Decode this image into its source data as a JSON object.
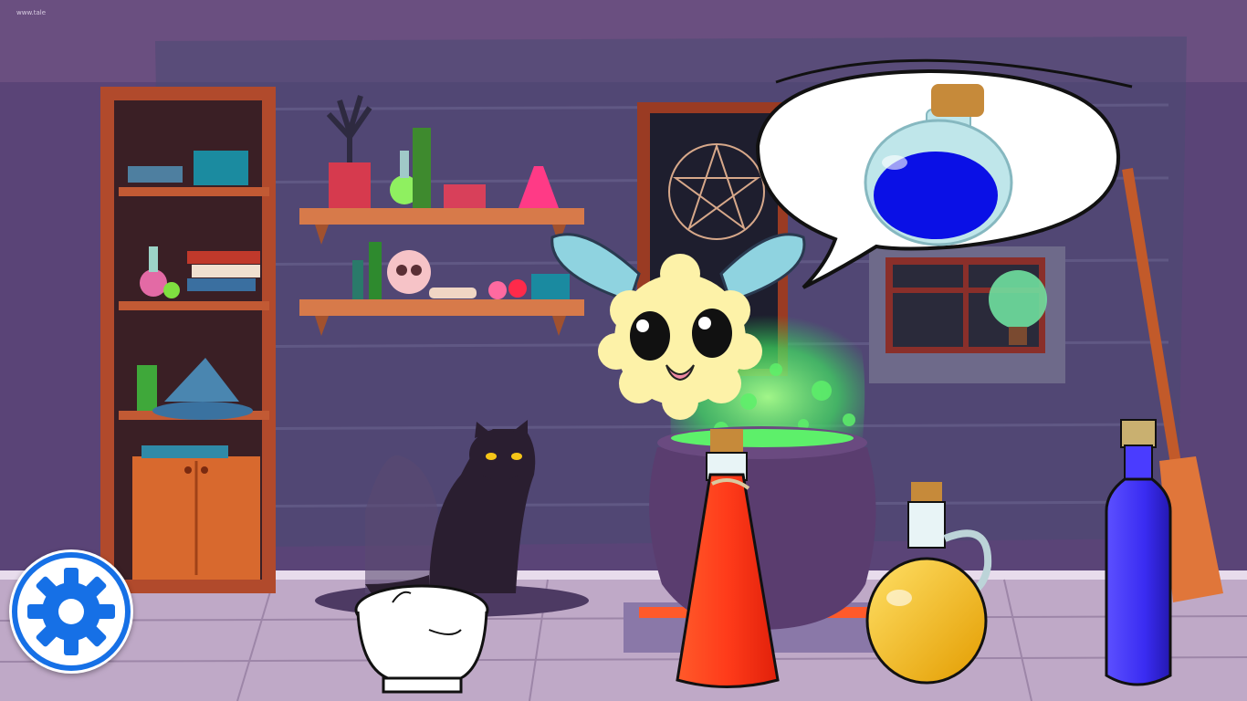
{
  "hud": {
    "corner_label": "www.tale",
    "settings_icon": "gear-icon"
  },
  "request": {
    "potion_color": "#0a10e6",
    "icon": "blue-potion-flask-icon"
  },
  "ingredients": [
    {
      "name": "empty-mortar-bowl",
      "icon": "mortar-bowl-icon"
    },
    {
      "name": "red-potion-bottle",
      "icon": "red-flask-icon",
      "color": "#ff3b1a"
    },
    {
      "name": "yellow-potion-jug",
      "icon": "yellow-jug-icon",
      "color": "#f4b400"
    },
    {
      "name": "blue-potion-bottle",
      "icon": "blue-bottle-icon",
      "color": "#3a2cf2"
    }
  ],
  "colors": {
    "wall": "#5a4477",
    "floor": "#bfa9c7",
    "cauldron_glow": "#5df06a",
    "gear": "#1670e6"
  }
}
